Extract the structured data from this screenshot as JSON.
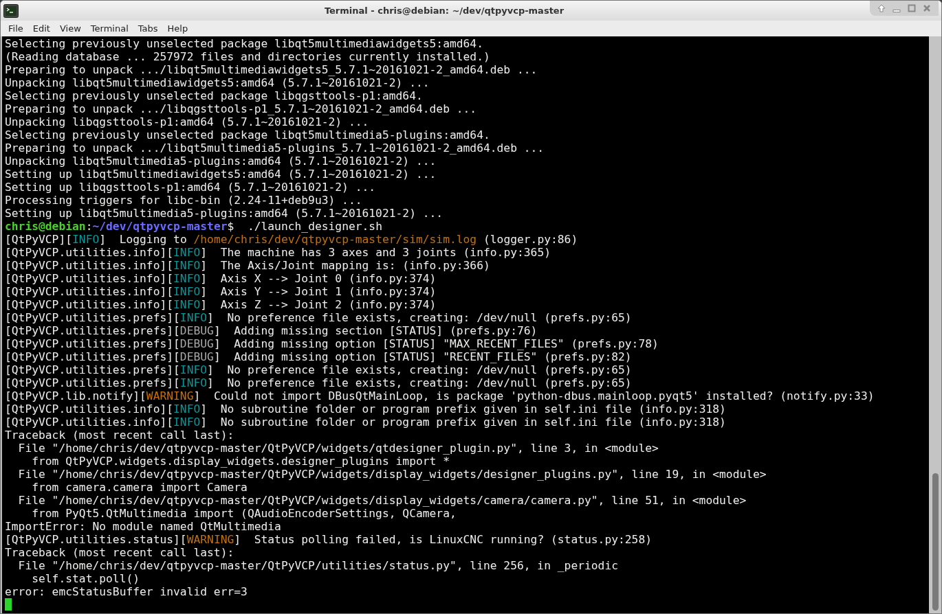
{
  "window": {
    "title": "Terminal - chris@debian: ~/dev/qtpyvcp-master"
  },
  "menu": [
    "File",
    "Edit",
    "View",
    "Terminal",
    "Tabs",
    "Help"
  ],
  "lines": [
    {
      "spans": [
        {
          "kind": "plain",
          "text": "Selecting previously unselected package libqt5multimediawidgets5:amd64."
        }
      ]
    },
    {
      "spans": [
        {
          "kind": "plain",
          "text": "(Reading database ... 257972 files and directories currently installed.)"
        }
      ]
    },
    {
      "spans": [
        {
          "kind": "plain",
          "text": "Preparing to unpack .../libqt5multimediawidgets5_5.7.1~20161021-2_amd64.deb ..."
        }
      ]
    },
    {
      "spans": [
        {
          "kind": "plain",
          "text": "Unpacking libqt5multimediawidgets5:amd64 (5.7.1~20161021-2) ..."
        }
      ]
    },
    {
      "spans": [
        {
          "kind": "plain",
          "text": "Selecting previously unselected package libqgsttools-p1:amd64."
        }
      ]
    },
    {
      "spans": [
        {
          "kind": "plain",
          "text": "Preparing to unpack .../libqgsttools-p1_5.7.1~20161021-2_amd64.deb ..."
        }
      ]
    },
    {
      "spans": [
        {
          "kind": "plain",
          "text": "Unpacking libqgsttools-p1:amd64 (5.7.1~20161021-2) ..."
        }
      ]
    },
    {
      "spans": [
        {
          "kind": "plain",
          "text": "Selecting previously unselected package libqt5multimedia5-plugins:amd64."
        }
      ]
    },
    {
      "spans": [
        {
          "kind": "plain",
          "text": "Preparing to unpack .../libqt5multimedia5-plugins_5.7.1~20161021-2_amd64.deb ..."
        }
      ]
    },
    {
      "spans": [
        {
          "kind": "plain",
          "text": "Unpacking libqt5multimedia5-plugins:amd64 (5.7.1~20161021-2) ..."
        }
      ]
    },
    {
      "spans": [
        {
          "kind": "plain",
          "text": "Setting up libqt5multimediawidgets5:amd64 (5.7.1~20161021-2) ..."
        }
      ]
    },
    {
      "spans": [
        {
          "kind": "plain",
          "text": "Setting up libqgsttools-p1:amd64 (5.7.1~20161021-2) ..."
        }
      ]
    },
    {
      "spans": [
        {
          "kind": "plain",
          "text": "Processing triggers for libc-bin (2.24-11+deb9u3) ..."
        }
      ]
    },
    {
      "spans": [
        {
          "kind": "plain",
          "text": "Setting up libqt5multimedia5-plugins:amd64 (5.7.1~20161021-2) ..."
        }
      ]
    },
    {
      "spans": [
        {
          "kind": "user",
          "text": "chris@debian"
        },
        {
          "kind": "plain",
          "text": ":"
        },
        {
          "kind": "dir",
          "text": "~/dev/qtpyvcp-master"
        },
        {
          "kind": "plain",
          "text": "$  ./launch_designer.sh"
        }
      ]
    },
    {
      "spans": [
        {
          "kind": "plain",
          "text": "[QtPyVCP]["
        },
        {
          "kind": "info",
          "text": "INFO"
        },
        {
          "kind": "plain",
          "text": "]  Logging to "
        },
        {
          "kind": "file",
          "text": "/home/chris/dev/qtpyvcp-master/sim/sim.log"
        },
        {
          "kind": "plain",
          "text": " (logger.py:86)"
        }
      ]
    },
    {
      "spans": [
        {
          "kind": "plain",
          "text": "[QtPyVCP.utilities.info]["
        },
        {
          "kind": "info",
          "text": "INFO"
        },
        {
          "kind": "plain",
          "text": "]  The machine has 3 axes and 3 joints (info.py:365)"
        }
      ]
    },
    {
      "spans": [
        {
          "kind": "plain",
          "text": "[QtPyVCP.utilities.info]["
        },
        {
          "kind": "info",
          "text": "INFO"
        },
        {
          "kind": "plain",
          "text": "]  The Axis/Joint mapping is: (info.py:366)"
        }
      ]
    },
    {
      "spans": [
        {
          "kind": "plain",
          "text": "[QtPyVCP.utilities.info]["
        },
        {
          "kind": "info",
          "text": "INFO"
        },
        {
          "kind": "plain",
          "text": "]  Axis X --> Joint 0 (info.py:374)"
        }
      ]
    },
    {
      "spans": [
        {
          "kind": "plain",
          "text": "[QtPyVCP.utilities.info]["
        },
        {
          "kind": "info",
          "text": "INFO"
        },
        {
          "kind": "plain",
          "text": "]  Axis Y --> Joint 1 (info.py:374)"
        }
      ]
    },
    {
      "spans": [
        {
          "kind": "plain",
          "text": "[QtPyVCP.utilities.info]["
        },
        {
          "kind": "info",
          "text": "INFO"
        },
        {
          "kind": "plain",
          "text": "]  Axis Z --> Joint 2 (info.py:374)"
        }
      ]
    },
    {
      "spans": [
        {
          "kind": "plain",
          "text": "[QtPyVCP.utilities.prefs]["
        },
        {
          "kind": "info",
          "text": "INFO"
        },
        {
          "kind": "plain",
          "text": "]  No preference file exists, creating: /dev/null (prefs.py:65)"
        }
      ]
    },
    {
      "spans": [
        {
          "kind": "plain",
          "text": "[QtPyVCP.utilities.prefs]["
        },
        {
          "kind": "debug",
          "text": "DEBUG"
        },
        {
          "kind": "plain",
          "text": "]  Adding missing section [STATUS] (prefs.py:76)"
        }
      ]
    },
    {
      "spans": [
        {
          "kind": "plain",
          "text": "[QtPyVCP.utilities.prefs]["
        },
        {
          "kind": "debug",
          "text": "DEBUG"
        },
        {
          "kind": "plain",
          "text": "]  Adding missing option [STATUS] \"MAX_RECENT_FILES\" (prefs.py:78)"
        }
      ]
    },
    {
      "spans": [
        {
          "kind": "plain",
          "text": "[QtPyVCP.utilities.prefs]["
        },
        {
          "kind": "debug",
          "text": "DEBUG"
        },
        {
          "kind": "plain",
          "text": "]  Adding missing option [STATUS] \"RECENT_FILES\" (prefs.py:82)"
        }
      ]
    },
    {
      "spans": [
        {
          "kind": "plain",
          "text": "[QtPyVCP.utilities.prefs]["
        },
        {
          "kind": "info",
          "text": "INFO"
        },
        {
          "kind": "plain",
          "text": "]  No preference file exists, creating: /dev/null (prefs.py:65)"
        }
      ]
    },
    {
      "spans": [
        {
          "kind": "plain",
          "text": "[QtPyVCP.utilities.prefs]["
        },
        {
          "kind": "info",
          "text": "INFO"
        },
        {
          "kind": "plain",
          "text": "]  No preference file exists, creating: /dev/null (prefs.py:65)"
        }
      ]
    },
    {
      "spans": [
        {
          "kind": "plain",
          "text": "[QtPyVCP.lib.notify]["
        },
        {
          "kind": "warning",
          "text": "WARNING"
        },
        {
          "kind": "plain",
          "text": "]  Could not import DBusQtMainLoop, is package 'python-dbus.mainloop.pyqt5' installed? (notify.py:33)"
        }
      ]
    },
    {
      "spans": [
        {
          "kind": "plain",
          "text": "[QtPyVCP.utilities.info]["
        },
        {
          "kind": "info",
          "text": "INFO"
        },
        {
          "kind": "plain",
          "text": "]  No subroutine folder or program prefix given in self.ini file (info.py:318)"
        }
      ]
    },
    {
      "spans": [
        {
          "kind": "plain",
          "text": "[QtPyVCP.utilities.info]["
        },
        {
          "kind": "info",
          "text": "INFO"
        },
        {
          "kind": "plain",
          "text": "]  No subroutine folder or program prefix given in self.ini file (info.py:318)"
        }
      ]
    },
    {
      "spans": [
        {
          "kind": "plain",
          "text": "Traceback (most recent call last):"
        }
      ]
    },
    {
      "spans": [
        {
          "kind": "plain",
          "text": "  File \"/home/chris/dev/qtpyvcp-master/QtPyVCP/widgets/qtdesigner_plugin.py\", line 3, in <module>"
        }
      ]
    },
    {
      "spans": [
        {
          "kind": "plain",
          "text": "    from QtPyVCP.widgets.display_widgets.designer_plugins import *"
        }
      ]
    },
    {
      "spans": [
        {
          "kind": "plain",
          "text": "  File \"/home/chris/dev/qtpyvcp-master/QtPyVCP/widgets/display_widgets/designer_plugins.py\", line 19, in <module>"
        }
      ]
    },
    {
      "spans": [
        {
          "kind": "plain",
          "text": "    from camera.camera import Camera"
        }
      ]
    },
    {
      "spans": [
        {
          "kind": "plain",
          "text": "  File \"/home/chris/dev/qtpyvcp-master/QtPyVCP/widgets/display_widgets/camera/camera.py\", line 51, in <module>"
        }
      ]
    },
    {
      "spans": [
        {
          "kind": "plain",
          "text": "    from PyQt5.QtMultimedia import (QAudioEncoderSettings, QCamera,"
        }
      ]
    },
    {
      "spans": [
        {
          "kind": "plain",
          "text": "ImportError: No module named QtMultimedia"
        }
      ]
    },
    {
      "spans": [
        {
          "kind": "plain",
          "text": "[QtPyVCP.utilities.status]["
        },
        {
          "kind": "warning",
          "text": "WARNING"
        },
        {
          "kind": "plain",
          "text": "]  Status polling failed, is LinuxCNC running? (status.py:258)"
        }
      ]
    },
    {
      "spans": [
        {
          "kind": "plain",
          "text": "Traceback (most recent call last):"
        }
      ]
    },
    {
      "spans": [
        {
          "kind": "plain",
          "text": "  File \"/home/chris/dev/qtpyvcp-master/QtPyVCP/utilities/status.py\", line 256, in _periodic"
        }
      ]
    },
    {
      "spans": [
        {
          "kind": "plain",
          "text": "    self.stat.poll()"
        }
      ]
    },
    {
      "spans": [
        {
          "kind": "plain",
          "text": "error: emcStatusBuffer invalid err=3"
        }
      ]
    }
  ]
}
